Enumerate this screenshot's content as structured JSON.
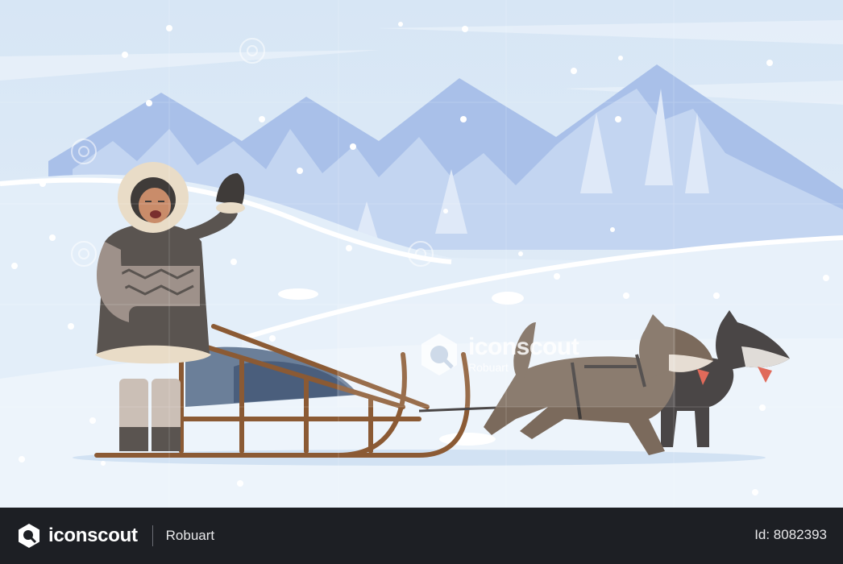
{
  "watermark": {
    "brand": "iconscout",
    "author": "Robuart"
  },
  "footer": {
    "brand": "iconscout",
    "author": "Robuart",
    "asset_id": "Id: 8082393"
  },
  "illustration": {
    "subject": "Inuit man waving beside a wooden sled pulled by two husky dogs in a snowy mountain landscape",
    "colors": {
      "sky": "#dbe8f6",
      "mountain_dark": "#a8bfe8",
      "mountain_light": "#c9d9f2",
      "snow": "#e6f0f9",
      "parka": "#5a5450",
      "fur": "#e9dcc7",
      "sled_wood": "#8b5a34",
      "husky_brown": "#7b6a5c",
      "husky_dark": "#4a4646"
    }
  }
}
